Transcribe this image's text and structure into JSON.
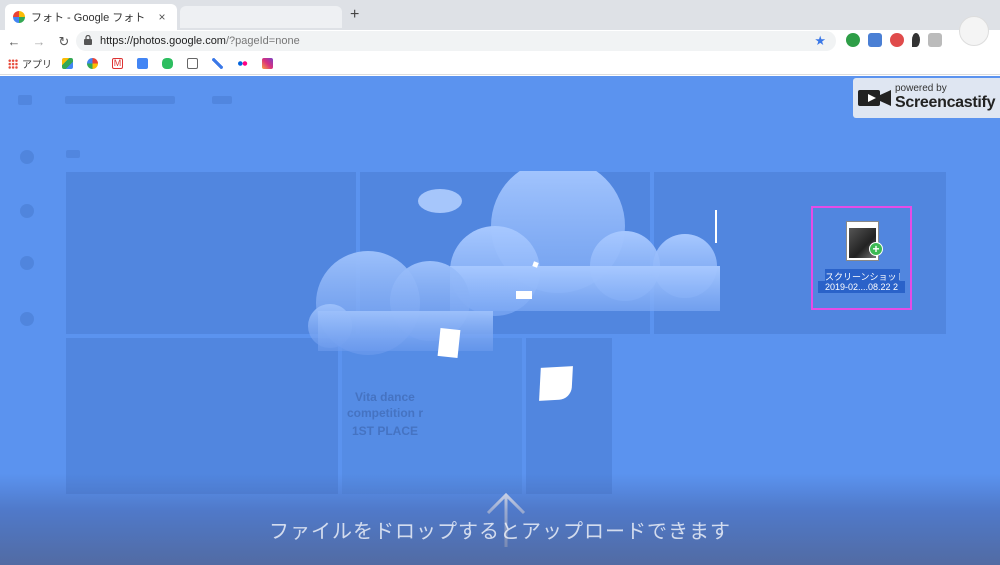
{
  "browser": {
    "tab": {
      "title": "フォト - Google フォト",
      "close": "×"
    },
    "new_tab": "+",
    "nav": {
      "back": "←",
      "forward": "→",
      "reload": "↻"
    },
    "url": {
      "host": "https://photos.google.com",
      "path": "/?pageId=none"
    },
    "bookmarks": {
      "apps_label": "アプリ"
    }
  },
  "overlay": {
    "drop_message": "ファイルをドロップするとアップロードできます"
  },
  "screencastify": {
    "powered_by": "powered by",
    "brand": "Screencastify"
  },
  "dragged_file": {
    "name_line1": "スクリーンショット",
    "name_line2": "2019-02....08.22 2"
  },
  "background_post": {
    "lines": [
      "Vita dance",
      "competition r",
      "1ST PLACE"
    ]
  },
  "colors": {
    "overlay_blue": "#5b93ef",
    "drag_highlight": "#e64ce6",
    "badge_bg": "#dfe6f2"
  }
}
